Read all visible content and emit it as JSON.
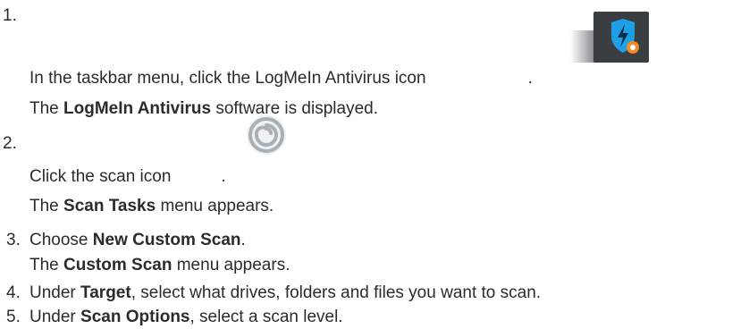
{
  "steps": [
    {
      "number": "1.",
      "line1_pre": "In the taskbar menu, click the LogMeIn Antivirus icon",
      "line1_post": ".",
      "line2_pre": "The ",
      "line2_bold": "LogMeIn Antivirus",
      "line2_post": " software is displayed.",
      "icon": "logmein-antivirus-shield-icon"
    },
    {
      "number": "2.",
      "line1_pre": "Click the scan icon",
      "line1_post": ".",
      "line2_pre": "The ",
      "line2_bold": "Scan Tasks",
      "line2_post": " menu appears.",
      "icon": "scan-spiral-icon"
    },
    {
      "number": "3.",
      "line1_pre": "Choose ",
      "line1_bold": "New Custom Scan",
      "line1_post": ".",
      "line2_pre": "The ",
      "line2_bold": "Custom Scan",
      "line2_post": " menu appears."
    },
    {
      "number": "4.",
      "line1_pre": "Under ",
      "line1_bold": "Target",
      "line1_post": ", select what drives, folders and files you want to scan."
    },
    {
      "number": "5.",
      "line1_pre": "Under ",
      "line1_bold": "Scan Options",
      "line1_post": ", select a scan level."
    }
  ],
  "colors": {
    "text": "#2b2b2b",
    "icon_background": "#3a3d42",
    "shield_blue": "#1ea0e6",
    "badge_orange": "#f28c28",
    "scan_icon_gray": "#a9b0b5"
  }
}
